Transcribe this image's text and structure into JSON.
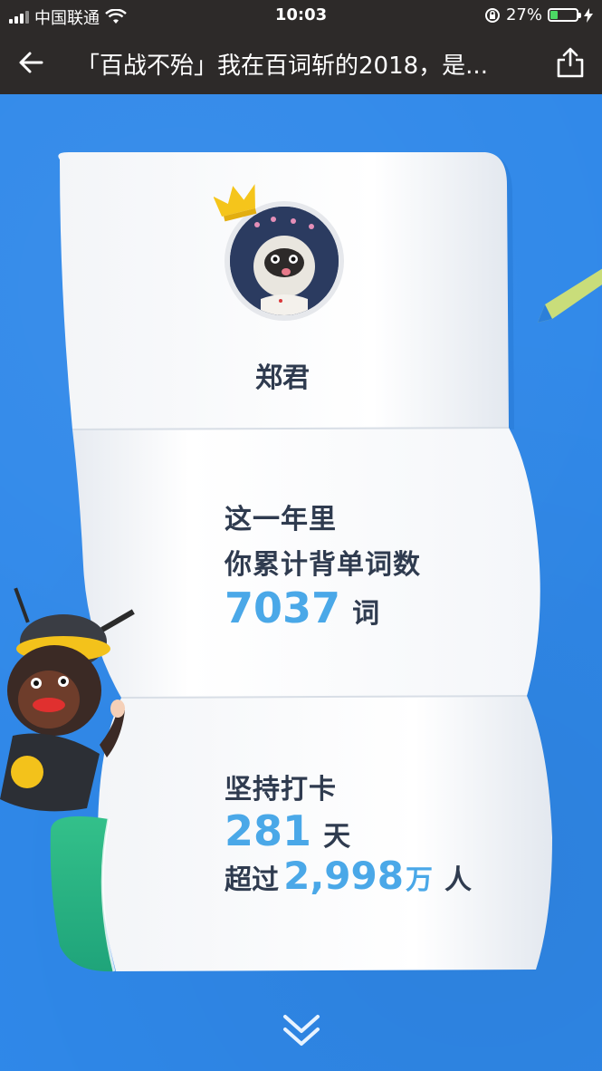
{
  "status_bar": {
    "carrier": "中国联通",
    "time": "10:03",
    "battery_percent": "27%",
    "battery_level": 0.27
  },
  "nav": {
    "title": "「百战不殆」我在百词斩的2018，是..."
  },
  "profile": {
    "name": "郑君"
  },
  "words_section": {
    "line1": "这一年里",
    "line2": "你累计背单词数",
    "count": "7037",
    "unit": "词"
  },
  "checkin_section": {
    "line1": "坚持打卡",
    "days": "281",
    "days_unit": "天",
    "exceed_prefix": "超过",
    "exceed_number": "2,998",
    "exceed_unit": "万",
    "exceed_suffix": "人"
  },
  "colors": {
    "background_blue": "#2f88e9",
    "accent_number": "#4aa8e8",
    "text_dark": "#2f3b4f",
    "nav_bar": "#2d2a29"
  },
  "icons": [
    "back-arrow-icon",
    "share-icon",
    "wifi-icon",
    "rotation-lock-icon",
    "charging-icon",
    "chevron-double-down-icon",
    "crown-icon",
    "pencil-icon"
  ]
}
